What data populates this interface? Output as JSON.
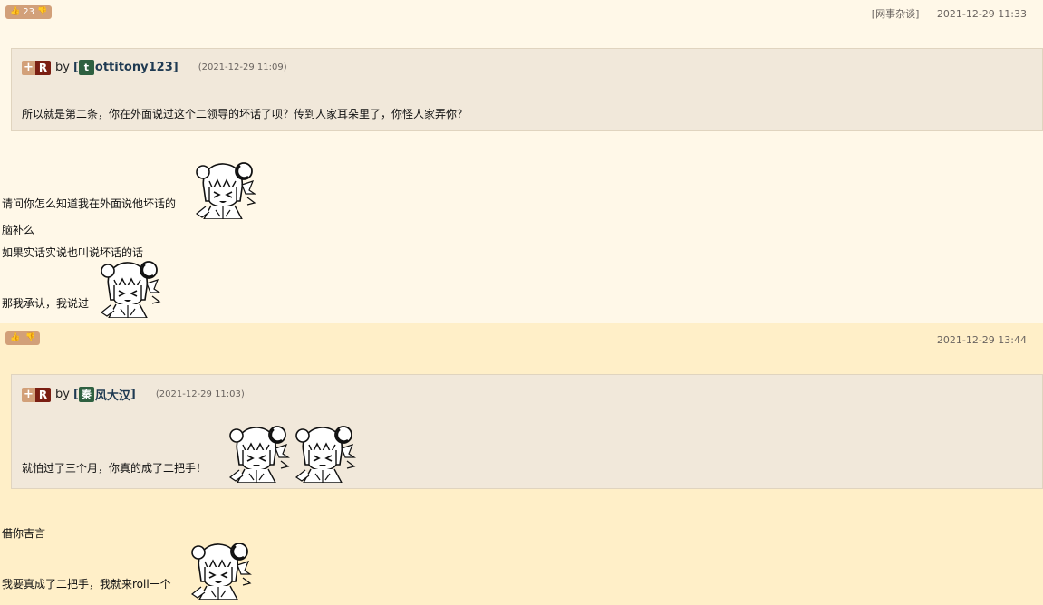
{
  "posts": [
    {
      "vote_count": "23",
      "category": "[网事杂谈]",
      "time": "2021-12-29 11:33",
      "quote": {
        "plus": "+",
        "r": "R",
        "by": "by",
        "bracket_open": "[",
        "avatar_char": "t",
        "username": "ottitony123",
        "bracket_close": "]",
        "time": "(2021-12-29 11:09)",
        "text": "所以就是第二条，你在外面说过这个二领导的坏话了呗？传到人家耳朵里了，你怪人家弄你？"
      },
      "lines": [
        "请问你怎么知道我在外面说他坏话的",
        "脑补么",
        "如果实话实说也叫说坏话的话",
        "那我承认，我说过"
      ]
    },
    {
      "vote_count": "",
      "category": "",
      "time": "2021-12-29 13:44",
      "quote": {
        "plus": "+",
        "r": "R",
        "by": "by",
        "bracket_open": "[",
        "avatar_char": "秦",
        "username": "风大汉",
        "bracket_close": "]",
        "time": "(2021-12-29 11:03)",
        "text": "就怕过了三个月，你真的成了二把手！"
      },
      "lines": [
        "借你吉言",
        "我要真成了二把手，我就来roll一个"
      ]
    }
  ],
  "icons": {
    "thumb_up": "thumbs-up-icon",
    "thumb_down": "thumbs-down-icon",
    "sticker": "anime-girl-sticker"
  },
  "colors": {
    "post_bg_1": "#fff8e8",
    "post_bg_2": "#ffefc8",
    "quote_bg": "#f1e8da",
    "vote_bg": "#d2a079",
    "r_badge": "#7a1e12",
    "avatar_bg": "#2e6040",
    "username": "#1f3a52"
  }
}
